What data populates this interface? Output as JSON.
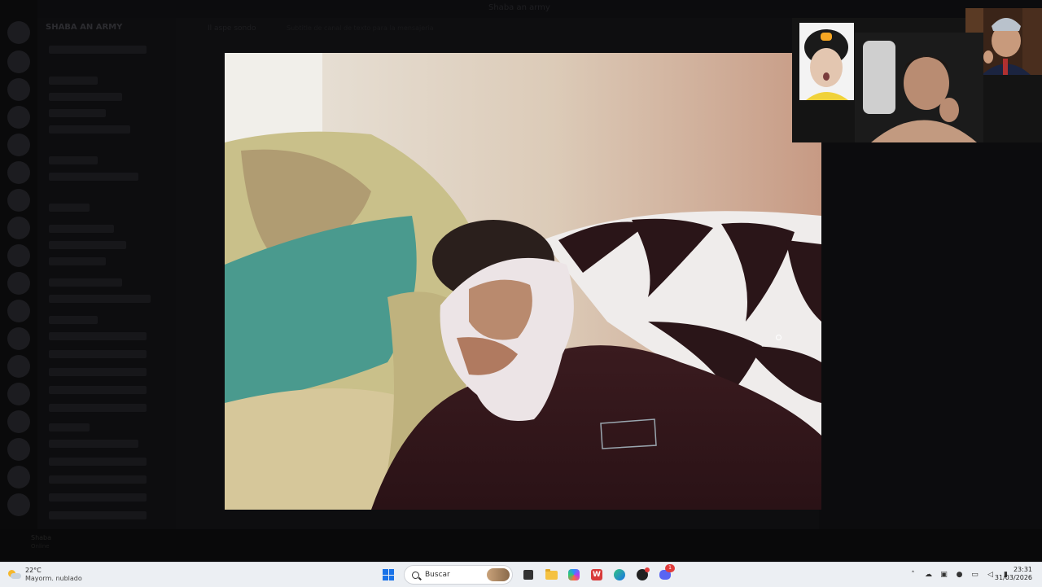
{
  "discord": {
    "window_title": "Shaba an army",
    "server_name": "SHABA AN ARMY",
    "channel_title": "Il aspe sondo",
    "channel_description": "Subtitle de canal de texto para la mensajeria",
    "user_name": "Shaba",
    "user_status": "Online"
  },
  "taskbar": {
    "weather_temp": "22°C",
    "weather_condition": "Mayorm. nublado",
    "search_placeholder": "Buscar",
    "discord_badge": "1",
    "time": "23:31",
    "date": "31/03/2026"
  },
  "colors": {
    "discord_accent": "#5865f2",
    "windows_accent": "#1a73e8"
  }
}
